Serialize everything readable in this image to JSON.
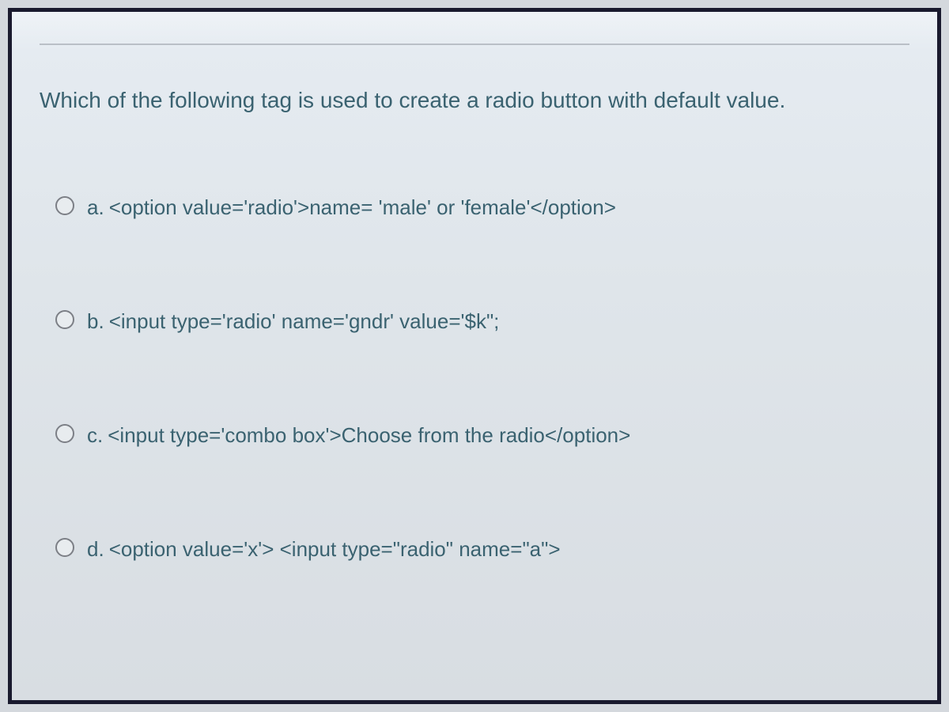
{
  "question": "Which of the following tag is used to create a radio button with default value.",
  "options": {
    "a": {
      "label": "a.",
      "text": "<option value='radio'>name= 'male' or 'female'</option>"
    },
    "b": {
      "label": "b.",
      "text": "<input type='radio' name='gndr' value='$k\";"
    },
    "c": {
      "label": "c.",
      "text": "<input type='combo box'>Choose from the radio</option>"
    },
    "d": {
      "label": "d.",
      "text": "<option value='x'> <input type=\"radio\" name=\"a\">"
    }
  }
}
